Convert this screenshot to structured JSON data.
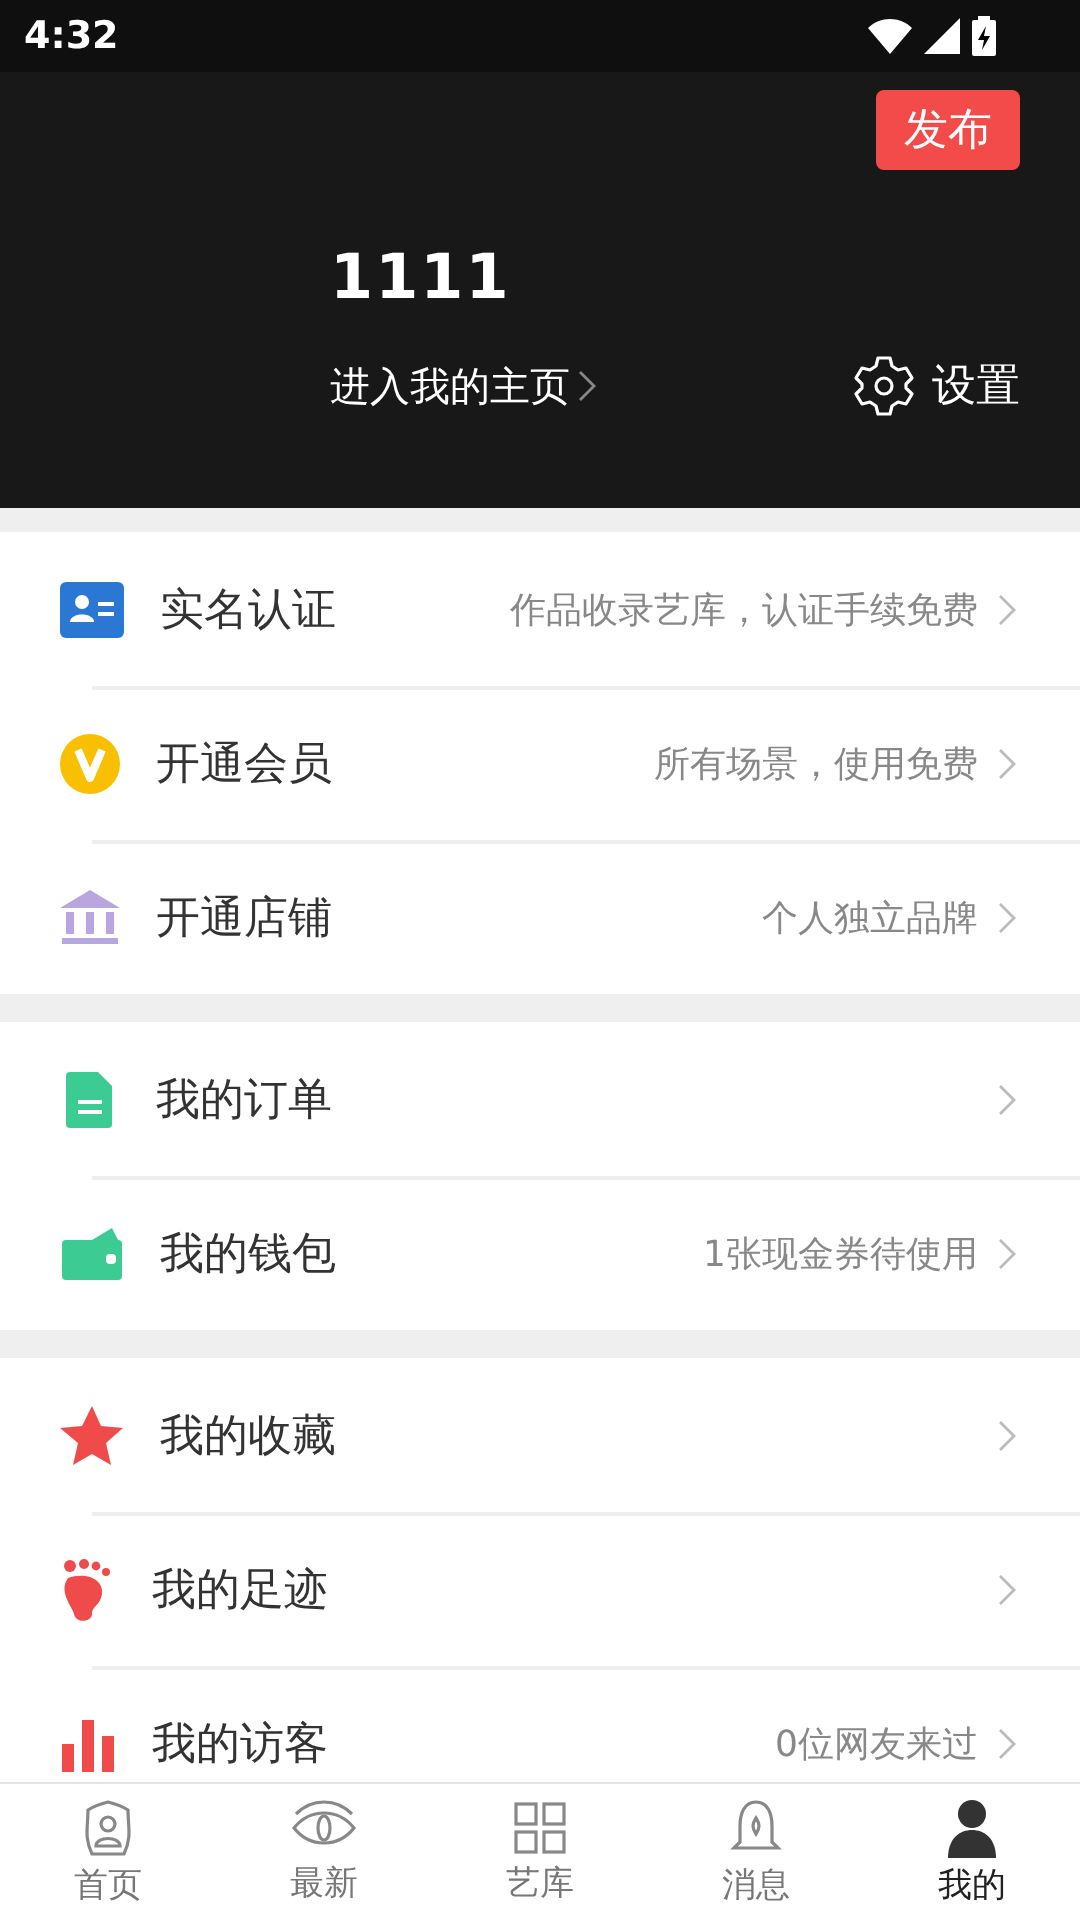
{
  "status_bar": {
    "time": "4:32"
  },
  "header": {
    "publish_button": "发布",
    "username": "1111",
    "homepage_link": "进入我的主页",
    "settings": "设置"
  },
  "sections": [
    {
      "items": [
        {
          "label": "实名认证",
          "hint": "作品收录艺库，认证手续免费"
        },
        {
          "label": "开通会员",
          "hint": "所有场景，使用免费"
        },
        {
          "label": "开通店铺",
          "hint": "个人独立品牌"
        }
      ]
    },
    {
      "items": [
        {
          "label": "我的订单"
        },
        {
          "label": "我的钱包",
          "hint": "1张现金券待使用"
        }
      ]
    },
    {
      "items": [
        {
          "label": "我的收藏"
        },
        {
          "label": "我的足迹"
        },
        {
          "label": "我的访客",
          "hint": "0位网友来过"
        }
      ]
    }
  ],
  "bottom_nav": [
    {
      "label": "首页",
      "selected": false
    },
    {
      "label": "最新",
      "selected": false
    },
    {
      "label": "艺库",
      "selected": false
    },
    {
      "label": "消息",
      "selected": false
    },
    {
      "label": "我的",
      "selected": true
    }
  ]
}
